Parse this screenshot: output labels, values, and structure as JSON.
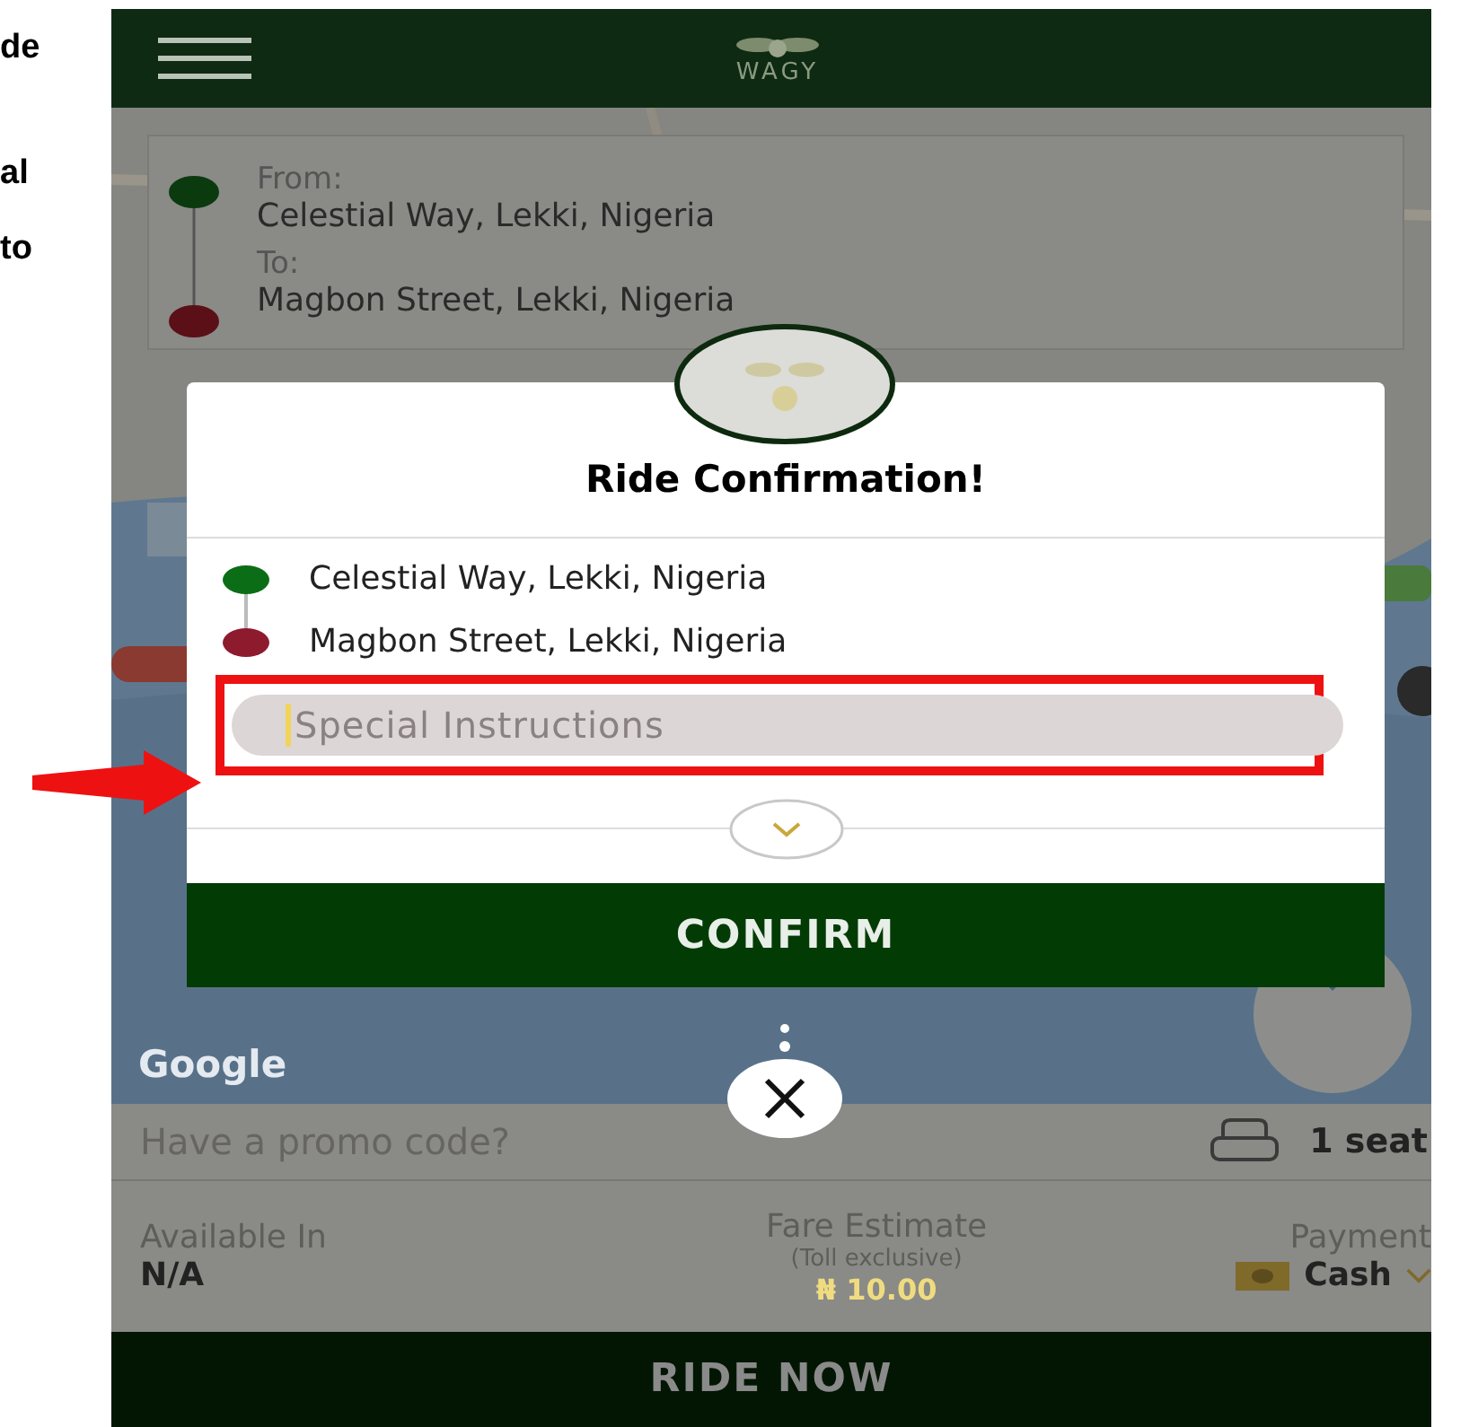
{
  "side_text": [
    "de",
    "al",
    "to"
  ],
  "header": {
    "logo": "WAGY"
  },
  "route": {
    "from_label": "From:",
    "from": "Celestial Way, Lekki, Nigeria",
    "to_label": "To:",
    "to": "Magbon Street, Lekki, Nigeria"
  },
  "dialog": {
    "title": "Ride Confirmation!",
    "stops": [
      {
        "address": "Celestial Way, Lekki, Nigeria",
        "color": "#0b6e16"
      },
      {
        "address": "Magbon Street, Lekki, Nigeria",
        "color": "#8e1a2e"
      }
    ],
    "instructions": {
      "placeholder": "Special Instructions",
      "highlighted": true
    },
    "confirm": "CONFIRM"
  },
  "map": {
    "attribution": "Google"
  },
  "promo": {
    "placeholder": "Have a promo code?",
    "seats": "1 seat"
  },
  "summary": {
    "available_label": "Available In",
    "available": "N/A",
    "fare_label": "Fare Estimate",
    "fare_note": "(Toll exclusive)",
    "fare": "₦ 10.00",
    "payment_label": "Payment",
    "payment": "Cash"
  },
  "ride_button": "RIDE NOW"
}
